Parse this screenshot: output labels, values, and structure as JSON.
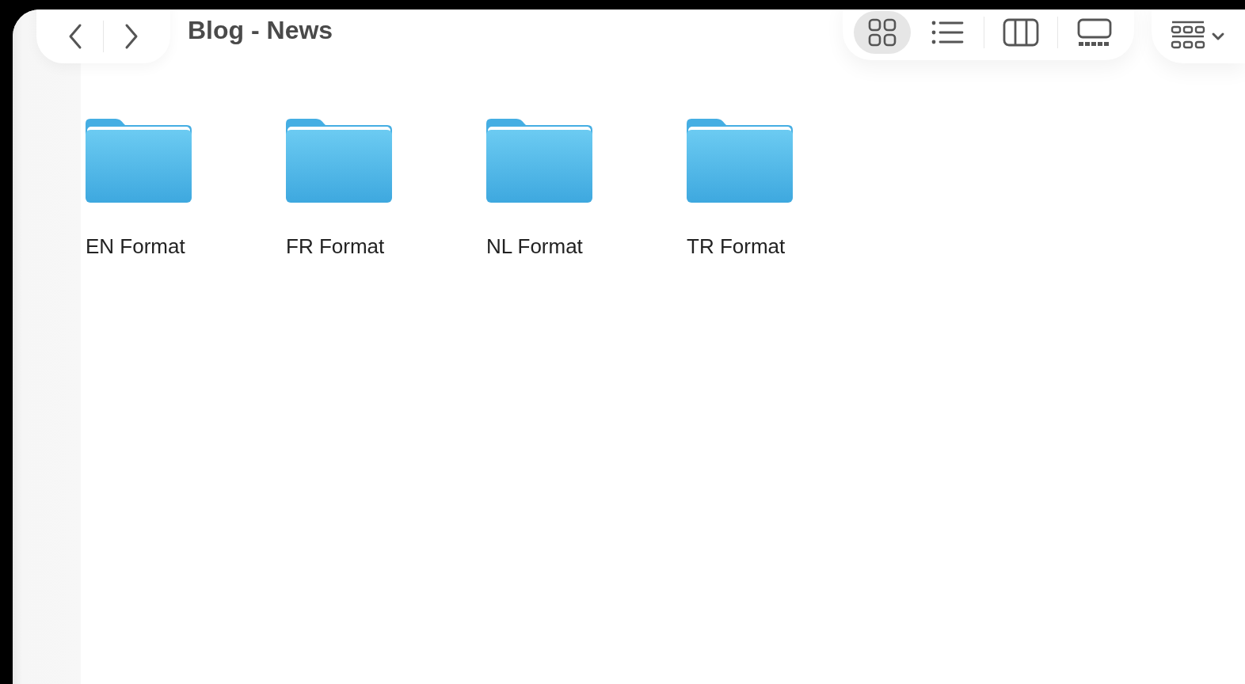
{
  "window": {
    "title": "Blog - News"
  },
  "view_modes": [
    {
      "kind": "icons",
      "selected": true
    },
    {
      "kind": "list",
      "selected": false
    },
    {
      "kind": "columns",
      "selected": false
    },
    {
      "kind": "gallery",
      "selected": false
    }
  ],
  "folders": [
    {
      "name": "EN Format"
    },
    {
      "name": "FR Format"
    },
    {
      "name": "NL Format"
    },
    {
      "name": "TR Format"
    }
  ]
}
